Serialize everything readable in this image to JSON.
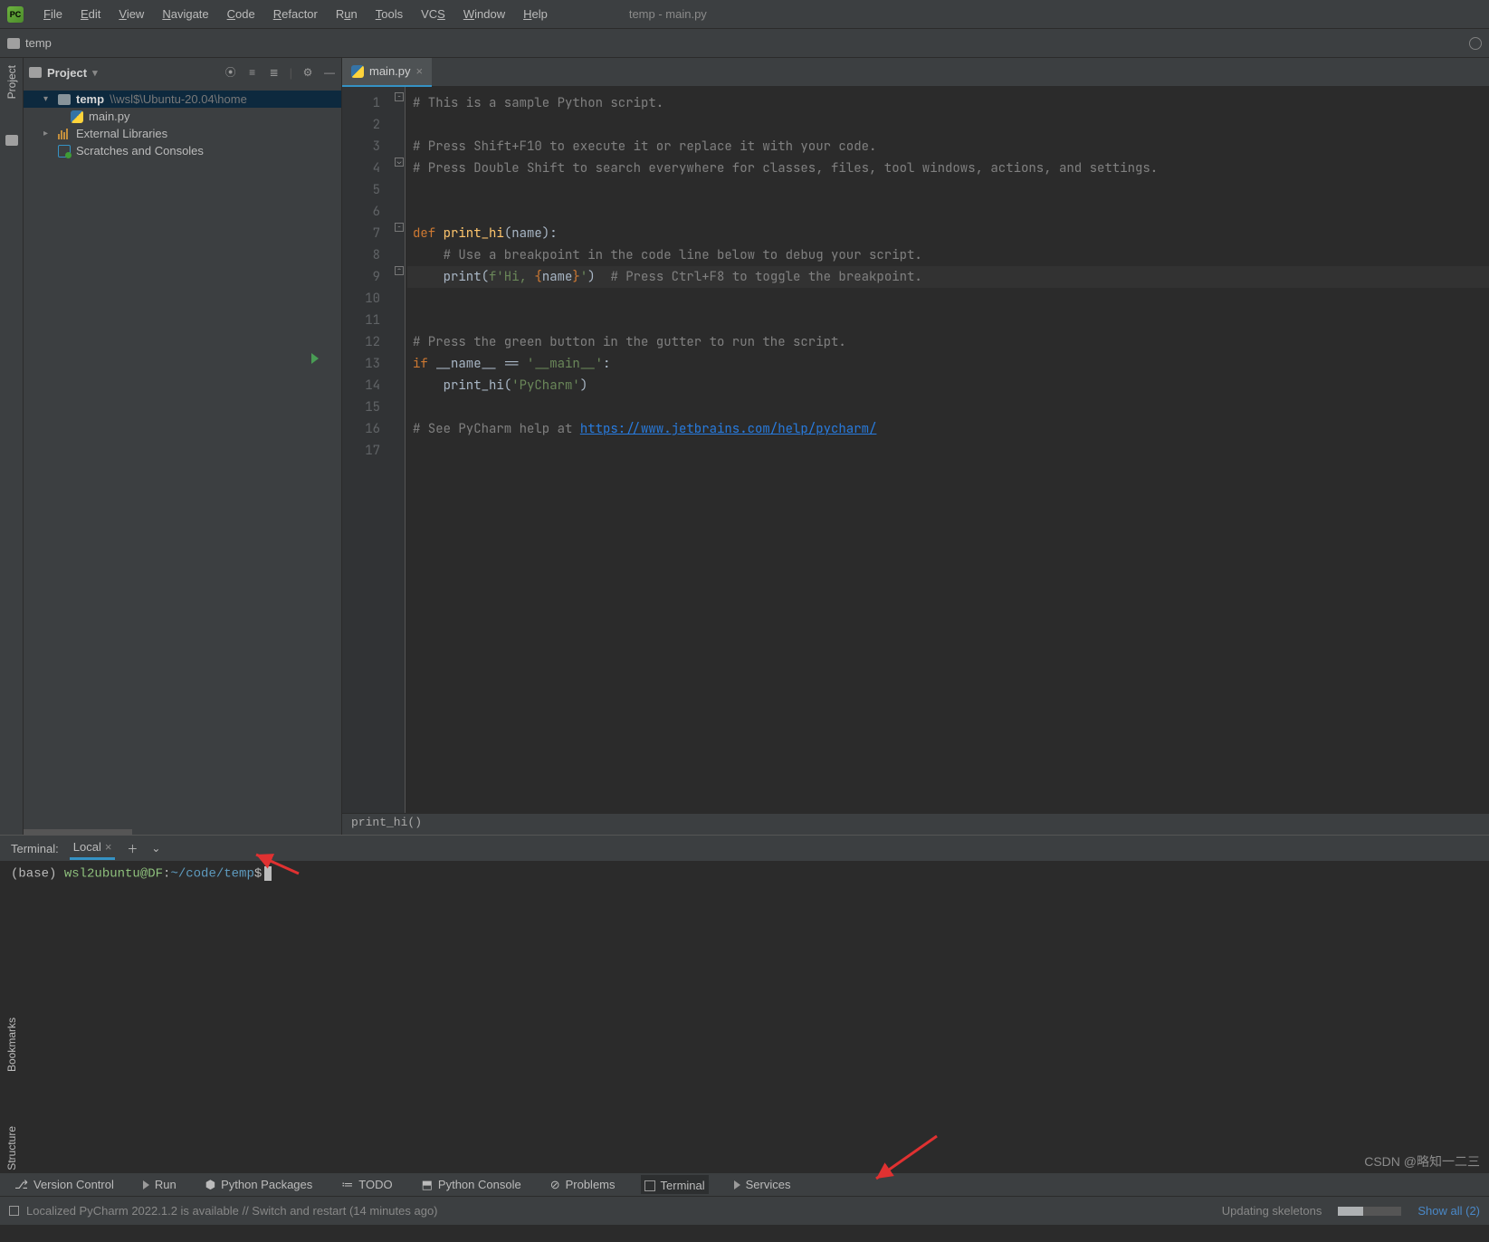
{
  "window": {
    "title": "temp - main.py"
  },
  "menus": [
    "File",
    "Edit",
    "View",
    "Navigate",
    "Code",
    "Refactor",
    "Run",
    "Tools",
    "VCS",
    "Window",
    "Help"
  ],
  "nav": {
    "crumb": "temp"
  },
  "left_stripe": {
    "top": "Project",
    "bottom1": "Bookmarks",
    "bottom2": "Structure"
  },
  "project_panel": {
    "title": "Project",
    "root": {
      "name": "temp",
      "path": "\\\\wsl$\\Ubuntu-20.04\\home"
    },
    "file1": "main.py",
    "ext": "External Libraries",
    "scr": "Scratches and Consoles"
  },
  "editor_tab": {
    "file": "main.py"
  },
  "gutter_lines": [
    "1",
    "2",
    "3",
    "4",
    "5",
    "6",
    "7",
    "8",
    "9",
    "10",
    "11",
    "12",
    "13",
    "14",
    "15",
    "16",
    "17"
  ],
  "code": {
    "l1_a": "# This is a sample Python script.",
    "l3_a": "# Press Shift+F10 to execute it or replace it with your code.",
    "l4_a": "# Press Double Shift to search everywhere for classes, files, tool windows, actions, and settings.",
    "l7_def": "def ",
    "l7_fn": "print_hi",
    "l7_tail": "(name):",
    "l8_a": "    # Use a breakpoint in the code line below to debug your script.",
    "l9_a": "    print(",
    "l9_b": "f'Hi, ",
    "l9_c": "{",
    "l9_c2": "name",
    "l9_c3": "}",
    "l9_d": "'",
    "l9_e": ")  ",
    "l9_f": "# Press Ctrl+F8 to toggle the breakpoint.",
    "l12_a": "# Press the green button in the gutter to run the script.",
    "l13_if": "if ",
    "l13_nm": "__name__",
    "l13_eq": " == ",
    "l13_st": "'__main__'",
    "l13_co": ":",
    "l14_a": "    print_hi(",
    "l14_b": "'PyCharm'",
    "l14_c": ")",
    "l16_a": "# See PyCharm help at ",
    "l16_url": "https://www.jetbrains.com/help/pycharm/"
  },
  "breadcrumb_fn": "print_hi()",
  "terminal": {
    "label": "Terminal:",
    "tab": "Local",
    "prompt_base": "(base) ",
    "prompt_user": "wsl2ubuntu@DF",
    "prompt_sep": ":",
    "prompt_path": "~/code/temp",
    "prompt_dollar": "$"
  },
  "bottom_bar": {
    "vcs": "Version Control",
    "run": "Run",
    "pkg": "Python Packages",
    "todo": "TODO",
    "pycon": "Python Console",
    "prob": "Problems",
    "term": "Terminal",
    "svc": "Services"
  },
  "status": {
    "left": "Localized PyCharm 2022.1.2 is available // Switch and restart (14 minutes ago)",
    "updating": "Updating skeletons",
    "showall": "Show all (2)"
  },
  "watermark": "CSDN @略知一二三"
}
